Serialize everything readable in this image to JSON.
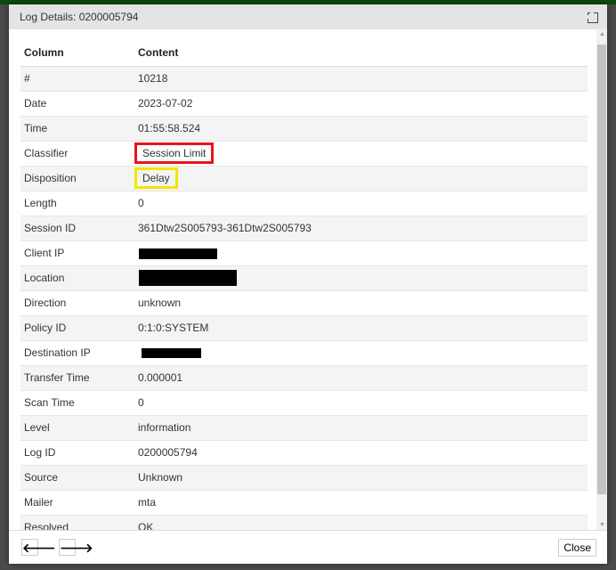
{
  "dialog": {
    "title": "Log Details: 0200005794",
    "close_label": "Close",
    "prev_icon": "arrow-left-icon",
    "next_icon": "arrow-right-icon"
  },
  "table": {
    "headers": [
      "Column",
      "Content"
    ],
    "rows": [
      {
        "column": "#",
        "content": "10218"
      },
      {
        "column": "Date",
        "content": "2023-07-02"
      },
      {
        "column": "Time",
        "content": "01:55:58.524"
      },
      {
        "column": "Classifier",
        "content": "Session Limit",
        "highlight": "#e8141c"
      },
      {
        "column": "Disposition",
        "content": "Delay",
        "highlight": "#f5e400"
      },
      {
        "column": "Length",
        "content": "0"
      },
      {
        "column": "Session ID",
        "content": "361Dtw2S005793-361Dtw2S005793"
      },
      {
        "column": "Client IP",
        "content": "",
        "redacted": true
      },
      {
        "column": "Location",
        "content": "",
        "redacted": true
      },
      {
        "column": "Direction",
        "content": "unknown"
      },
      {
        "column": "Policy ID",
        "content": "0:1:0:SYSTEM"
      },
      {
        "column": "Destination IP",
        "content": "",
        "redacted": true
      },
      {
        "column": "Transfer Time",
        "content": "0.000001"
      },
      {
        "column": "Scan Time",
        "content": "0"
      },
      {
        "column": "Level",
        "content": "information"
      },
      {
        "column": "Log ID",
        "content": "0200005794"
      },
      {
        "column": "Source",
        "content": "Unknown"
      },
      {
        "column": "Mailer",
        "content": "mta"
      },
      {
        "column": "Resolved",
        "content": "OK"
      }
    ]
  }
}
